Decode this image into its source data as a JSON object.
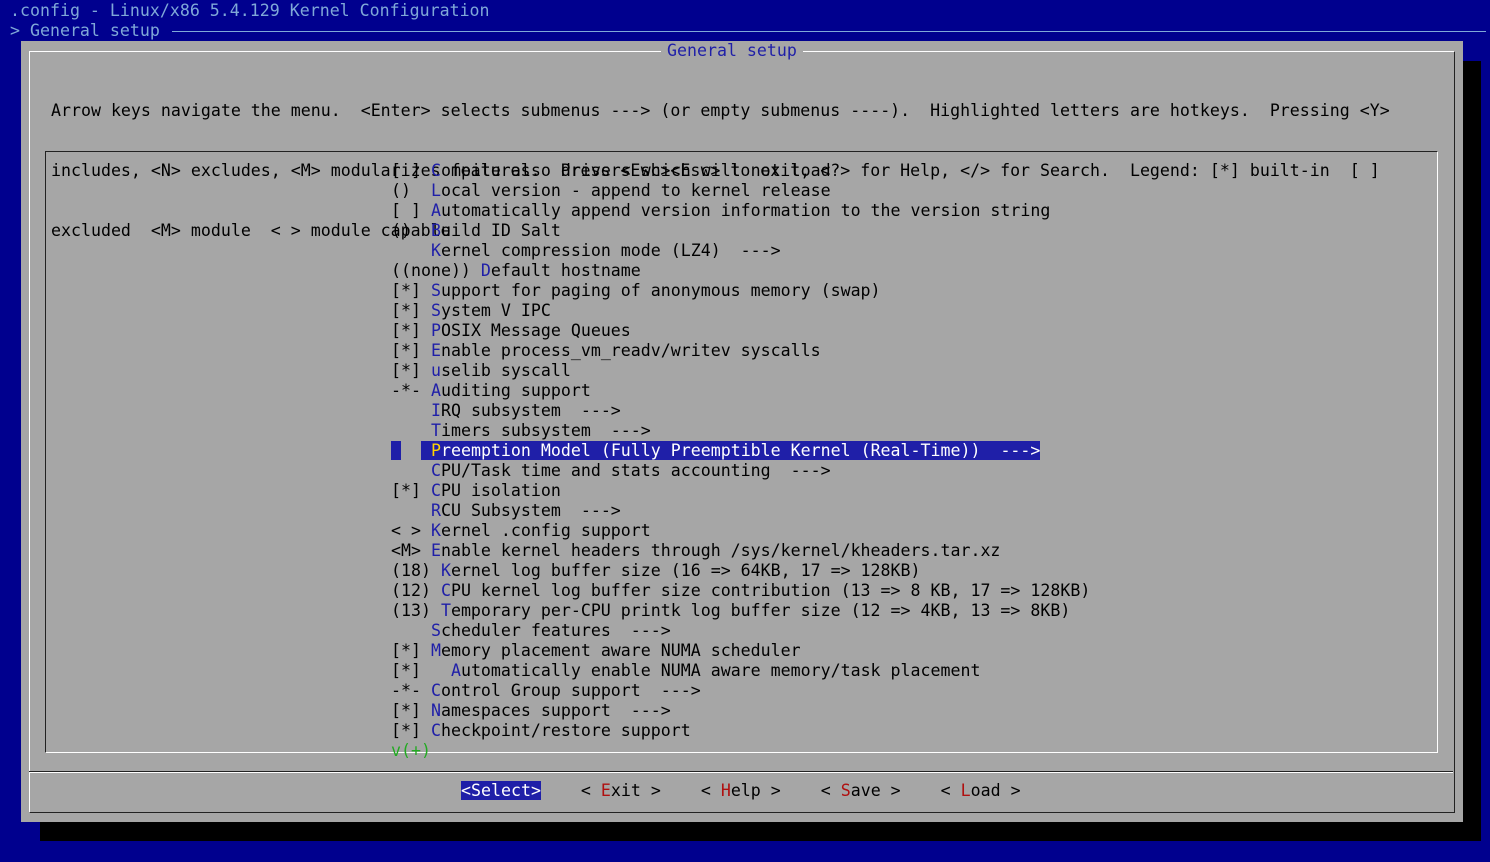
{
  "window": {
    "title": ".config - Linux/x86 5.4.129 Kernel Configuration",
    "breadcrumb": "> General setup"
  },
  "dialog": {
    "title": "General setup",
    "help_lines": [
      "Arrow keys navigate the menu.  <Enter> selects submenus ---> (or empty submenus ----).  Highlighted letters are hotkeys.  Pressing <Y>",
      "includes, <N> excludes, <M> modularizes features.  Press <Esc><Esc> to exit, <?> for Help, </> for Search.  Legend: [*] built-in  [ ]",
      "excluded  <M> module  < > module capable"
    ]
  },
  "menu": {
    "items": [
      {
        "prefix": "[ ] ",
        "hotkey": "C",
        "rest": "ompile also drivers which will not load"
      },
      {
        "prefix": "()  ",
        "hotkey": "L",
        "rest": "ocal version - append to kernel release"
      },
      {
        "prefix": "[ ] ",
        "hotkey": "A",
        "rest": "utomatically append version information to the version string"
      },
      {
        "prefix": "()  ",
        "hotkey": "B",
        "rest": "uild ID Salt"
      },
      {
        "prefix": "    ",
        "hotkey": "K",
        "rest": "ernel compression mode (LZ4)  --->"
      },
      {
        "prefix": "((none)) ",
        "hotkey": "D",
        "rest": "efault hostname"
      },
      {
        "prefix": "[*] ",
        "hotkey": "S",
        "rest": "upport for paging of anonymous memory (swap)"
      },
      {
        "prefix": "[*] ",
        "hotkey": "S",
        "rest": "ystem V IPC"
      },
      {
        "prefix": "[*] ",
        "hotkey": "P",
        "rest": "OSIX Message Queues"
      },
      {
        "prefix": "[*] ",
        "hotkey": "E",
        "rest": "nable process_vm_readv/writev syscalls"
      },
      {
        "prefix": "[*] ",
        "hotkey": "u",
        "rest": "selib syscall"
      },
      {
        "prefix": "-*- ",
        "hotkey": "A",
        "rest": "uditing support"
      },
      {
        "prefix": "    ",
        "hotkey": "I",
        "rest": "RQ subsystem  --->"
      },
      {
        "prefix": "    ",
        "hotkey": "T",
        "rest": "imers subsystem  --->"
      },
      {
        "prefix": "    ",
        "hotkey": "P",
        "rest": "reemption Model (Fully Preemptible Kernel (Real-Time))  --->",
        "selected": true
      },
      {
        "prefix": "    ",
        "hotkey": "C",
        "rest": "PU/Task time and stats accounting  --->"
      },
      {
        "prefix": "[*] ",
        "hotkey": "C",
        "rest": "PU isolation"
      },
      {
        "prefix": "    ",
        "hotkey": "R",
        "rest": "CU Subsystem  --->"
      },
      {
        "prefix": "< > ",
        "hotkey": "K",
        "rest": "ernel .config support"
      },
      {
        "prefix": "<M> ",
        "hotkey": "E",
        "rest": "nable kernel headers through /sys/kernel/kheaders.tar.xz"
      },
      {
        "prefix": "(18) ",
        "hotkey": "K",
        "rest": "ernel log buffer size (16 => 64KB, 17 => 128KB)"
      },
      {
        "prefix": "(12) ",
        "hotkey": "C",
        "rest": "PU kernel log buffer size contribution (13 => 8 KB, 17 => 128KB)"
      },
      {
        "prefix": "(13) ",
        "hotkey": "T",
        "rest": "emporary per-CPU printk log buffer size (12 => 4KB, 13 => 8KB)"
      },
      {
        "prefix": "    ",
        "hotkey": "S",
        "rest": "cheduler features  --->"
      },
      {
        "prefix": "[*] ",
        "hotkey": "M",
        "rest": "emory placement aware NUMA scheduler"
      },
      {
        "prefix": "[*]   ",
        "hotkey": "A",
        "rest": "utomatically enable NUMA aware memory/task placement"
      },
      {
        "prefix": "-*- ",
        "hotkey": "C",
        "rest": "ontrol Group support  --->"
      },
      {
        "prefix": "[*] ",
        "hotkey": "N",
        "rest": "amespaces support  --->"
      },
      {
        "prefix": "[*] ",
        "hotkey": "C",
        "rest": "heckpoint/restore support"
      }
    ],
    "more_indicator": "v(+)"
  },
  "buttons": [
    {
      "pre": "<",
      "hotkey": "S",
      "rest": "elect>",
      "active": true
    },
    {
      "pre": "< ",
      "hotkey": "E",
      "rest": "xit >",
      "active": false
    },
    {
      "pre": "< ",
      "hotkey": "H",
      "rest": "elp >",
      "active": false
    },
    {
      "pre": "< ",
      "hotkey": "S",
      "rest": "ave >",
      "active": false
    },
    {
      "pre": "< ",
      "hotkey": "L",
      "rest": "oad >",
      "active": false
    }
  ],
  "colors": {
    "background": "#00008e",
    "dialog": "#a6a6a6",
    "hotkey": "#1f1fa8",
    "selection": "#1f1fa8",
    "button_hotkey": "#b01010"
  }
}
